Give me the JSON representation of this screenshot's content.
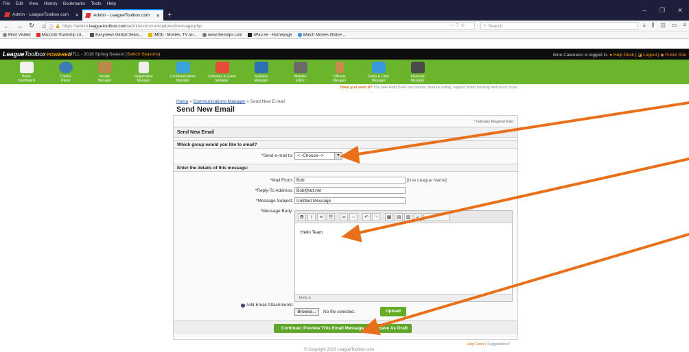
{
  "browser": {
    "menu": [
      "File",
      "Edit",
      "View",
      "History",
      "Bookmarks",
      "Tools",
      "Help"
    ],
    "tabs": [
      {
        "title": "Admin - LeagueToolbox.com",
        "active": false
      },
      {
        "title": "Admin - LeagueToolbox.com",
        "active": true
      }
    ],
    "new_tab": "+",
    "url_prefix": "https://admin.",
    "url_domain": "leaguetoolbox.com",
    "url_path": "/admin/communications/message.php",
    "url_icons": "··· ♡ ☆",
    "search_placeholder": "Search",
    "bookmarks": [
      {
        "label": "Most Visited",
        "color": "#888"
      },
      {
        "label": "Macomb Township Lit...",
        "color": "#d33"
      },
      {
        "label": "Easynews Global Searc...",
        "color": "#555"
      },
      {
        "label": "IMDb - Movies, TV an...",
        "color": "#e3b700"
      },
      {
        "label": "www.themdps.com",
        "color": "#777"
      },
      {
        "label": "xPau.se - Homepage",
        "color": "#222"
      },
      {
        "label": "Watch Movies Online ...",
        "color": "#3a8ee6"
      }
    ]
  },
  "league": {
    "logo_main": "League",
    "logo_tb": "Toolbox",
    "logo_powered": "POWERED",
    "season_prefix": "MTLL - 2018 Spring Season (",
    "season_switch": "Switch Seasons",
    "season_suffix": ")",
    "login_text": "Gino Catenacci is logged in.",
    "help_desk": "Help Desk",
    "logout": "Logout",
    "public_site": "Public Site",
    "nav": [
      {
        "label": "Home\nDashboard",
        "color": "#f2f2f2"
      },
      {
        "label": "Control\nPanel",
        "color": "#3d7bb3"
      },
      {
        "label": "People\nManager",
        "color": "#b98a4b"
      },
      {
        "label": "Registration\nManager",
        "color": "#eeeeee"
      },
      {
        "label": "Communications\nManager",
        "color": "#3aa3d9"
      },
      {
        "label": "Schedule & Game\nManager",
        "color": "#e84a3a"
      },
      {
        "label": "Statistics\nManager",
        "color": "#2d6fb0"
      },
      {
        "label": "Website\nEditor",
        "color": "#6a6a6a"
      },
      {
        "label": "Officials\nManager",
        "color": "#c98a50"
      },
      {
        "label": "Camp & Clinic\nManager",
        "color": "#3a9ad9"
      },
      {
        "label": "Financial\nManager",
        "color": "#4a4a4a"
      }
    ],
    "promo_bold": "Have you seen it?",
    "promo_text": "The new Help Desk has forums, feature voting, support ticket tracking and much more."
  },
  "form": {
    "breadcrumb_home": "Home",
    "breadcrumb_sep": " » ",
    "breadcrumb_comm": "Communications Manager",
    "breadcrumb_current": " » Send New E-mail",
    "title": "Send New Email",
    "required_note": "Indicates Required Field",
    "section_title": "Send New Email",
    "group_question": "Which group would you like to email?",
    "send_to_label": "*Send e-mail to:",
    "send_to_value": "<--Choose-->",
    "details_header": "Enter the details of this message:",
    "mail_from_label": "*Mail From:",
    "mail_from_value": "Bob",
    "use_league_name": "[Use League Name]",
    "reply_to_label": "*Reply-To Address:",
    "reply_to_value": "Bob@att.net",
    "subject_label": "*Message Subject:",
    "subject_value": "Untitled Message",
    "body_label": "*Message Body:",
    "body_text": "Hello Team",
    "editor_status": "body  p",
    "attach_label": "Add Email Attachments:",
    "browse_label": "Browse...",
    "no_file": "No file selected.",
    "upload_label": "Upload",
    "preview_label": "Continue: Preview This Email Message",
    "draft_label": "Save As Draft"
  },
  "footer": {
    "help_desk": "Help Desk",
    "suggestions": "Suggestions?",
    "copyright": "© Copyright 2013 LeagueToolbox.com"
  },
  "annotation_color": "#e8701a"
}
